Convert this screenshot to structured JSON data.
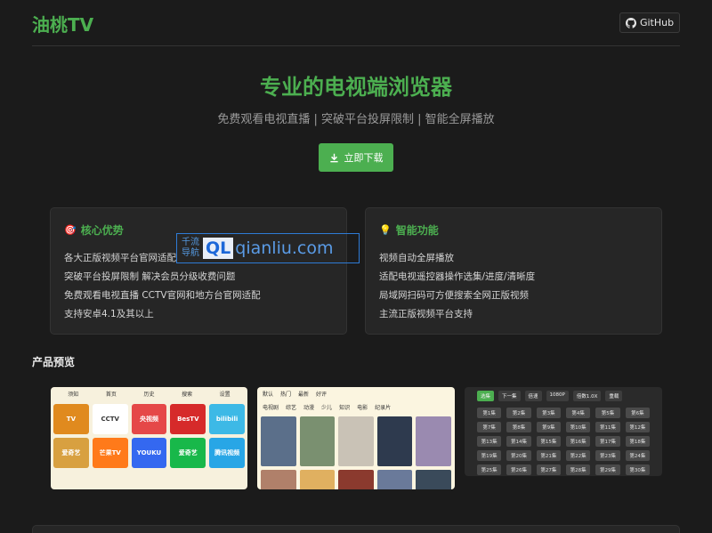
{
  "header": {
    "logo": "油桃TV",
    "github_label": "GitHub"
  },
  "hero": {
    "title": "专业的电视端浏览器",
    "subtitle": "免费观看电视直播 | 突破平台投屏限制 | 智能全屏播放",
    "download_label": "立即下载"
  },
  "cards": {
    "core": {
      "icon": "🎯",
      "title": "核心优势",
      "items": [
        "各大正版视频平台官网适配",
        "突破平台投屏限制 解决会员分级收费问题",
        "免费观看电视直播 CCTV官网和地方台官网适配",
        "支持安卓4.1及其以上"
      ]
    },
    "smart": {
      "icon": "💡",
      "title": "智能功能",
      "items": [
        "视频自动全屏播放",
        "适配电视遥控器操作选集/进度/清晰度",
        "局域网扫码可方便搜索全网正版视频",
        "主流正版视频平台支持"
      ]
    }
  },
  "watermark": {
    "cn_line1": "千流",
    "cn_line2": "导航",
    "ql": "QL",
    "domain": "qianliu.com"
  },
  "preview": {
    "title": "产品预览",
    "shot1": {
      "nav": [
        "须知",
        "首页",
        "历史",
        "搜索",
        "设置"
      ],
      "tiles": [
        {
          "label": "TV",
          "color": "#e08a1e"
        },
        {
          "label": "CCTV",
          "color": "#ffffff"
        },
        {
          "label": "央视频",
          "color": "#e54848"
        },
        {
          "label": "BesTV",
          "color": "#d62a2a"
        },
        {
          "label": "bilibili",
          "color": "#3db9e6"
        },
        {
          "label": "爱奇艺",
          "color": "#d8a040"
        },
        {
          "label": "芒果TV",
          "color": "#ff7a1a"
        },
        {
          "label": "YOUKU",
          "color": "#3468f0"
        },
        {
          "label": "爱奇艺",
          "color": "#18b84a"
        },
        {
          "label": "腾讯视频",
          "color": "#28a6e6"
        }
      ]
    },
    "shot2": {
      "tabs1": [
        "默认",
        "热门",
        "最新",
        "好评"
      ],
      "tabs2": [
        "电视剧",
        "综艺",
        "动漫",
        "少儿",
        "知识",
        "电影",
        "纪录片"
      ],
      "poster_colors": [
        "#5b6f8a",
        "#7a9070",
        "#c9c2b6",
        "#2e3a4e",
        "#9a8ab0",
        "#b0806a",
        "#e0b060",
        "#8b3a2e",
        "#6a7a9a",
        "#3a4a5a"
      ]
    },
    "shot3": {
      "chips": [
        "选集",
        "下一集",
        "倍速",
        "1080P",
        "倍数1.0X",
        "重载"
      ],
      "episodes": [
        "第1集",
        "第2集",
        "第3集",
        "第4集",
        "第5集",
        "第6集",
        "第7集",
        "第8集",
        "第9集",
        "第10集",
        "第11集",
        "第12集",
        "第13集",
        "第14集",
        "第15集",
        "第16集",
        "第17集",
        "第18集",
        "第19集",
        "第20集",
        "第21集",
        "第22集",
        "第23集",
        "第24集",
        "第25集",
        "第26集",
        "第27集",
        "第28集",
        "第29集",
        "第30集"
      ]
    }
  }
}
